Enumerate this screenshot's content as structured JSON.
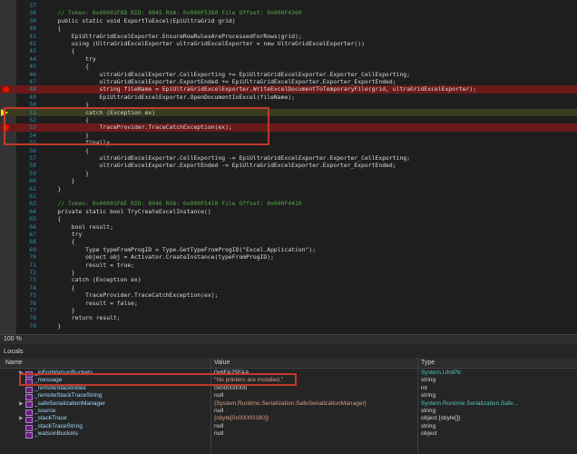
{
  "editor": {
    "lines": [
      {
        "n": "37",
        "text": "",
        "mark": "none"
      },
      {
        "n": "38",
        "text": "    // Token: 0x06001F6D RID: 8045 RVA: 0x000F5360 File Offset: 0x000F4360",
        "mark": "none"
      },
      {
        "n": "39",
        "text": "    public static void ExportToExcel(EpiUltraGrid grid)",
        "mark": "none"
      },
      {
        "n": "40",
        "text": "    {",
        "mark": "none"
      },
      {
        "n": "41",
        "text": "        EpiUltraGridExcelExporter.EnsureRowRulesAreProcessedForRows(grid);",
        "mark": "none"
      },
      {
        "n": "42",
        "text": "        using (UltraGridExcelExporter ultraGridExcelExporter = new UltraGridExcelExporter())",
        "mark": "none"
      },
      {
        "n": "43",
        "text": "        {",
        "mark": "none"
      },
      {
        "n": "44",
        "text": "            try",
        "mark": "none"
      },
      {
        "n": "45",
        "text": "            {",
        "mark": "none"
      },
      {
        "n": "46",
        "text": "                ultraGridExcelExporter.CellExporting += EpiUltraGridExcelExporter.Exporter_CellExporting;",
        "mark": "none"
      },
      {
        "n": "47",
        "text": "                ultraGridExcelExporter.ExportEnded += EpiUltraGridExcelExporter.Exporter_ExportEnded;",
        "mark": "none"
      },
      {
        "n": "48",
        "text": "                string fileName = EpiUltraGridExcelExporter.WriteExcelDocumentToTemporaryFile(grid, ultraGridExcelExporter);",
        "mark": "bp"
      },
      {
        "n": "49",
        "text": "                EpiUltraGridExcelExporter.OpenDocumentInExcel(fileName);",
        "mark": "none"
      },
      {
        "n": "50",
        "text": "            }",
        "mark": "none"
      },
      {
        "n": "51",
        "text": "            catch (Exception ex)",
        "mark": "arrow"
      },
      {
        "n": "52",
        "text": "            {",
        "mark": "none"
      },
      {
        "n": "53",
        "text": "                TraceProvider.TraceCatchException(ex);",
        "mark": "bp"
      },
      {
        "n": "54",
        "text": "            }",
        "mark": "none"
      },
      {
        "n": "55",
        "text": "            finally",
        "mark": "none"
      },
      {
        "n": "56",
        "text": "            {",
        "mark": "none"
      },
      {
        "n": "57",
        "text": "                ultraGridExcelExporter.CellExporting -= EpiUltraGridExcelExporter.Exporter_CellExporting;",
        "mark": "none"
      },
      {
        "n": "58",
        "text": "                ultraGridExcelExporter.ExportEnded -= EpiUltraGridExcelExporter.Exporter_ExportEnded;",
        "mark": "none"
      },
      {
        "n": "59",
        "text": "            }",
        "mark": "none"
      },
      {
        "n": "60",
        "text": "        }",
        "mark": "none"
      },
      {
        "n": "61",
        "text": "    }",
        "mark": "none"
      },
      {
        "n": "62",
        "text": "",
        "mark": "none"
      },
      {
        "n": "63",
        "text": "    // Token: 0x06001F6E RID: 8046 RVA: 0x000F5410 File Offset: 0x000F4410",
        "mark": "none"
      },
      {
        "n": "64",
        "text": "    private static bool TryCreateExcelInstance()",
        "mark": "none"
      },
      {
        "n": "65",
        "text": "    {",
        "mark": "none"
      },
      {
        "n": "66",
        "text": "        bool result;",
        "mark": "none"
      },
      {
        "n": "67",
        "text": "        try",
        "mark": "none"
      },
      {
        "n": "68",
        "text": "        {",
        "mark": "none"
      },
      {
        "n": "69",
        "text": "            Type typeFromProgID = Type.GetTypeFromProgID(\"Excel.Application\");",
        "mark": "none"
      },
      {
        "n": "70",
        "text": "            object obj = Activator.CreateInstance(typeFromProgID);",
        "mark": "none"
      },
      {
        "n": "71",
        "text": "            result = true;",
        "mark": "none"
      },
      {
        "n": "72",
        "text": "        }",
        "mark": "none"
      },
      {
        "n": "73",
        "text": "        catch (Exception ex)",
        "mark": "none"
      },
      {
        "n": "74",
        "text": "        {",
        "mark": "none"
      },
      {
        "n": "75",
        "text": "            TraceProvider.TraceCatchException(ex);",
        "mark": "none"
      },
      {
        "n": "76",
        "text": "            result = false;",
        "mark": "none"
      },
      {
        "n": "77",
        "text": "        }",
        "mark": "none"
      },
      {
        "n": "78",
        "text": "        return result;",
        "mark": "none"
      },
      {
        "n": "79",
        "text": "    }",
        "mark": "none"
      }
    ]
  },
  "zoom": "100 %",
  "locals": {
    "title": "Locals",
    "headers": {
      "name": "Name",
      "value": "Value",
      "type": "Type"
    },
    "rows": [
      {
        "expand": "▶",
        "name": "_ipForWatsonBuckets",
        "value": "0x6FA25FAA",
        "type": "System.UIntPtr",
        "type_color": "#4ec9b0"
      },
      {
        "expand": "",
        "name": "_message",
        "value": "\"No printers are installed.\"",
        "type": "string",
        "type_color": "#d4d4d4"
      },
      {
        "expand": "",
        "name": "_remoteStackIndex",
        "value": "0x00000000",
        "type": "int",
        "type_color": "#d4d4d4"
      },
      {
        "expand": "",
        "name": "_remoteStackTraceString",
        "value": "null",
        "type": "string",
        "type_color": "#d4d4d4"
      },
      {
        "expand": "▶",
        "name": "_safeSerializationManager",
        "value": "{System.Runtime.Serialization.SafeSerializationManager}",
        "type": "System.Runtime.Serialization.Safe...",
        "type_color": "#4ec9b0"
      },
      {
        "expand": "",
        "name": "_source",
        "value": "null",
        "type": "string",
        "type_color": "#d4d4d4"
      },
      {
        "expand": "▶",
        "name": "_stackTrace",
        "value": "{sbyte[0x00000180]}",
        "type": "object {sbyte[]}",
        "type_color": "#d4d4d4"
      },
      {
        "expand": "",
        "name": "_stackTraceString",
        "value": "null",
        "type": "string",
        "type_color": "#d4d4d4"
      },
      {
        "expand": "",
        "name": "_watsonBuckets",
        "value": "null",
        "type": "object",
        "type_color": "#d4d4d4"
      }
    ]
  }
}
